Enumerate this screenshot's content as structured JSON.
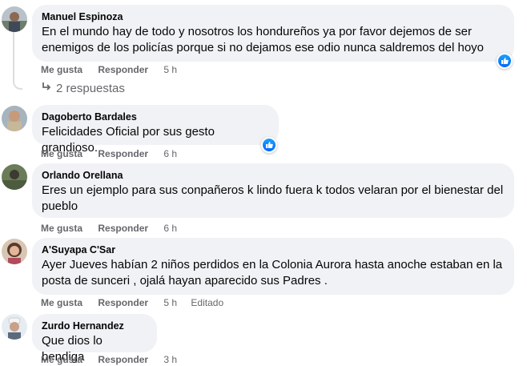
{
  "comments": [
    {
      "author": "Manuel Espinoza",
      "text": "En el mundo hay de todo y nosotros los hondureños ya por favor dejemos de ser enemigos de los policías porque si no dejamos ese odio nunca saldremos del hoyo",
      "like_label": "Me gusta",
      "reply_label": "Responder",
      "time": "5 h",
      "replies_label": "2 respuestas",
      "reaction": "like-icon"
    },
    {
      "author": "Dagoberto Bardales",
      "text": "Felicidades Oficial por sus gesto grandioso.",
      "like_label": "Me gusta",
      "reply_label": "Responder",
      "time": "6 h",
      "reaction": "like-icon"
    },
    {
      "author": "Orlando Orellana",
      "text": "Eres un ejemplo para sus conpañeros k lindo fuera k todos velaran por el bienestar del pueblo",
      "like_label": "Me gusta",
      "reply_label": "Responder",
      "time": "6 h"
    },
    {
      "author": "A'Suyapa C'Sar",
      "text": "Ayer Jueves habían 2 niños perdidos en la Colonia Aurora hasta anoche estaban en la posta de sunceri , ojalá hayan aparecido sus Padres .",
      "like_label": "Me gusta",
      "reply_label": "Responder",
      "time": "5 h",
      "edited_label": "Editado"
    },
    {
      "author": "Zurdo Hernandez",
      "text": "Que dios lo bendiga",
      "like_label": "Me gusta",
      "reply_label": "Responder",
      "time": "3 h"
    }
  ],
  "colors": {
    "bubble": "#f0f2f5",
    "meta": "#65676b",
    "like_blue": "#0566ff"
  }
}
